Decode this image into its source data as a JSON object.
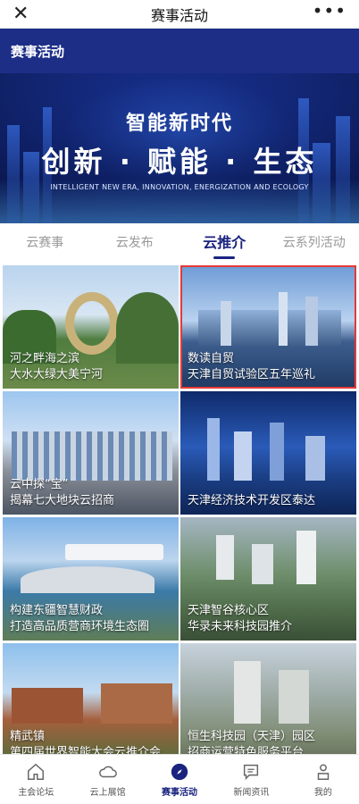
{
  "topbar": {
    "title": "赛事活动",
    "close_icon": "close-icon",
    "more_icon": "more-icon"
  },
  "header": {
    "title": "赛事活动"
  },
  "banner": {
    "line1": "智能新时代",
    "line2": "创新 · 赋能 · 生态",
    "line3": "INTELLIGENT NEW ERA, INNOVATION, ENERGIZATION AND ECOLOGY"
  },
  "tabs": [
    {
      "label": "云赛事"
    },
    {
      "label": "云发布"
    },
    {
      "label": "云推介"
    },
    {
      "label": "云系列活动"
    }
  ],
  "active_tab": 2,
  "cards": [
    {
      "line1": "河之畔海之滨",
      "line2": "大水大绿大美宁河"
    },
    {
      "line1": "数读自贸",
      "line2": "天津自贸试验区五年巡礼"
    },
    {
      "line1": "云中探“宝”",
      "line2": "揭幕七大地块云招商"
    },
    {
      "line1": "",
      "line2": "天津经济技术开发区泰达"
    },
    {
      "line1": "构建东疆智慧财政",
      "line2": "打造高品质营商环境生态圈"
    },
    {
      "line1": "天津智谷核心区",
      "line2": "华录未来科技园推介"
    },
    {
      "line1": "精武镇",
      "line2": "第四届世界智能大会云推介会"
    },
    {
      "line1": "恒生科技园（天津）园区",
      "line2": "招商运营特色服务平台"
    }
  ],
  "selected_card": 1,
  "nav": [
    {
      "label": "主会论坛",
      "icon": "home-icon"
    },
    {
      "label": "云上展馆",
      "icon": "cloud-icon"
    },
    {
      "label": "赛事活动",
      "icon": "compass-icon"
    },
    {
      "label": "新闻资讯",
      "icon": "message-icon"
    },
    {
      "label": "我的",
      "icon": "user-icon"
    }
  ],
  "colors": {
    "brand": "#1a237e",
    "header": "#1c2e86",
    "selected_outline": "#e53935"
  }
}
